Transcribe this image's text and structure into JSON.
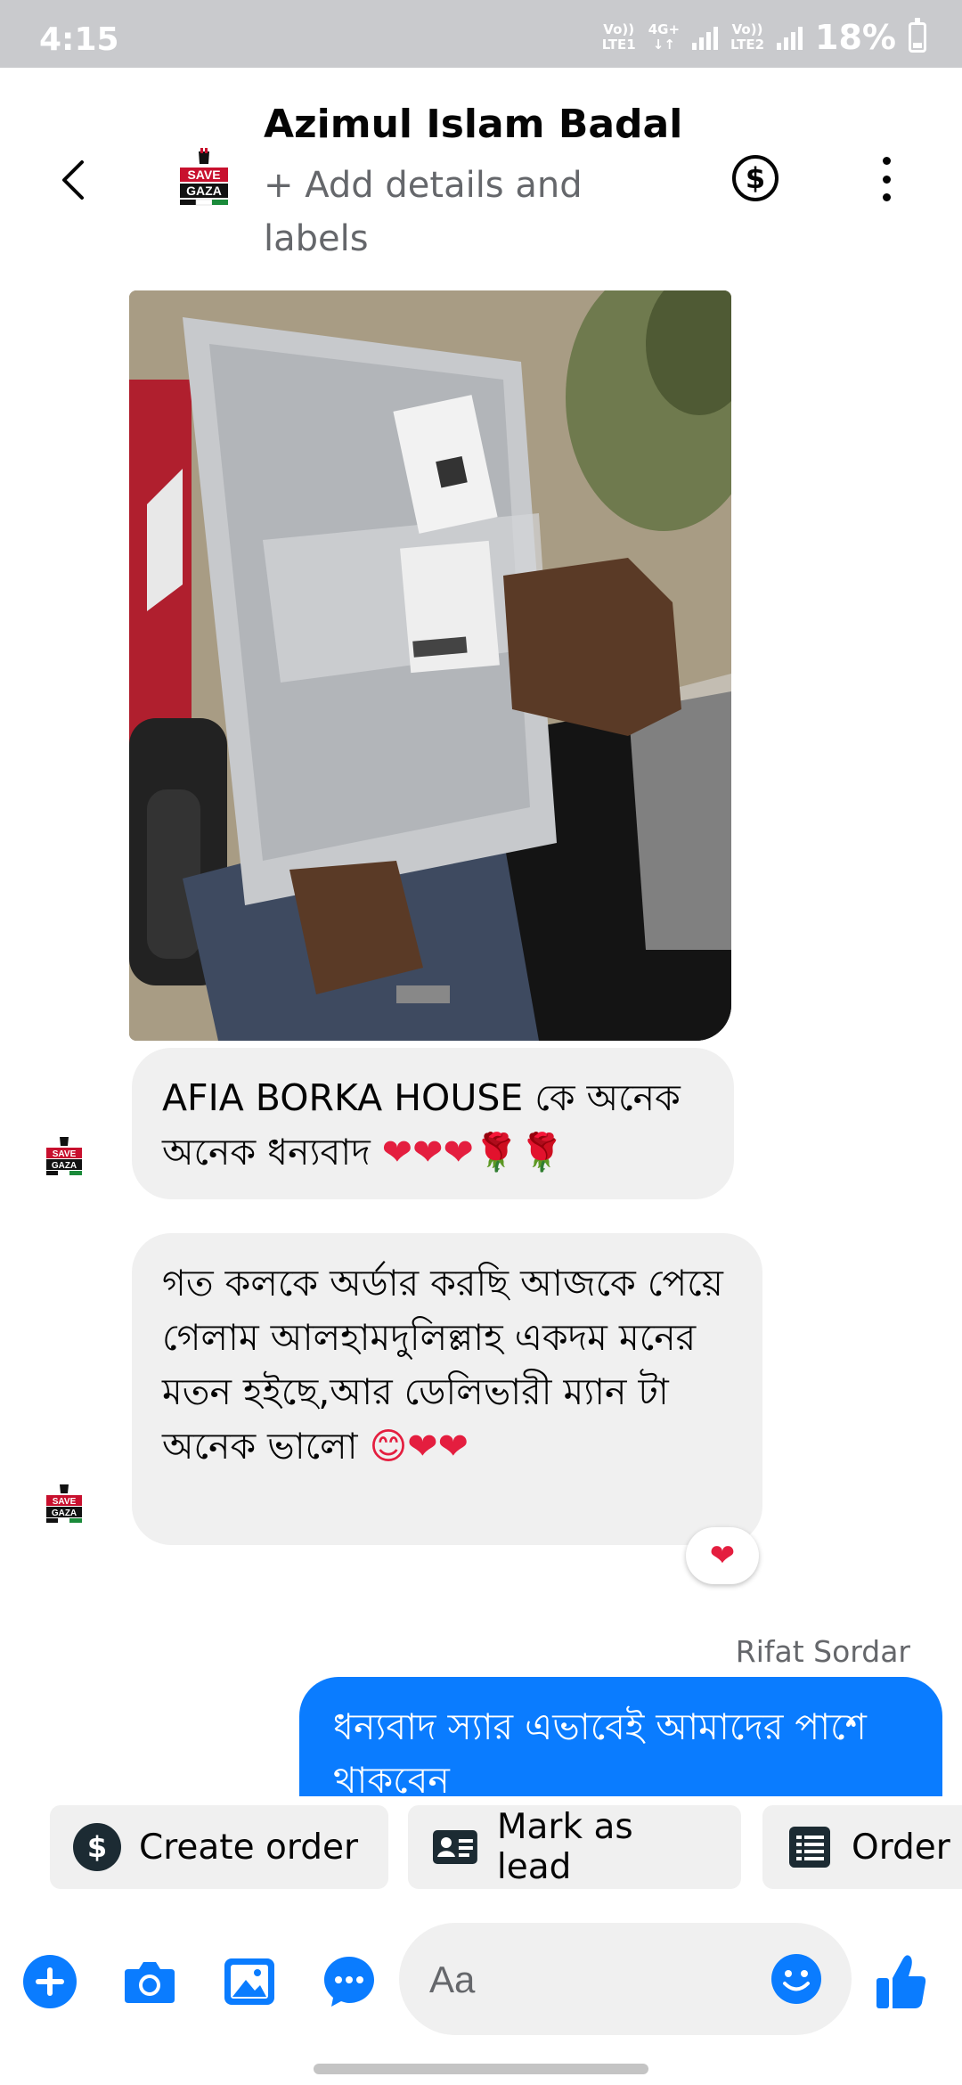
{
  "status_bar": {
    "time": "4:15",
    "sim1": "LTE1",
    "sim1_top": "Vo))",
    "net_top": "4G+",
    "sim2": "LTE2",
    "sim2_top": "Vo))",
    "battery": "18%"
  },
  "header": {
    "name": "Azimul Islam Badal",
    "subtitle": "+ Add details and labels",
    "avatar_text": "SAVE GAZA"
  },
  "messages": [
    {
      "type": "image",
      "from": "contact"
    },
    {
      "type": "text",
      "from": "contact",
      "text": "AFIA BORKA HOUSE কে  অনেক অনেক ধন্যবাদ ",
      "emojis": "❤❤❤🌹🌹"
    },
    {
      "type": "text",
      "from": "contact",
      "text": "গত কলকে অর্ডার করছি আজকে পেয়ে গেলাম আলহামদুলিল্লাহ একদম মনের মতন হইছে,আর ডেলিভারী ম্যান টা অনেক ভালো ",
      "emojis": "😊❤❤",
      "reaction": "❤"
    },
    {
      "type": "text",
      "from": "page",
      "sender": "Rifat Sordar",
      "text": "ধন্যবাদ স্যার এভাবেই আমাদের পাশে থাকবেন"
    }
  ],
  "quick_actions": {
    "create_order": "Create order",
    "mark_lead": "Mark as lead",
    "order": "Order"
  },
  "composer": {
    "placeholder": "Aa"
  },
  "colors": {
    "accent": "#0a7cff",
    "icon_blue": "#0a7cff",
    "bubble_gray": "#f0f0f0",
    "status_bar": "#c9cacd",
    "heart": "#e41e3f"
  }
}
